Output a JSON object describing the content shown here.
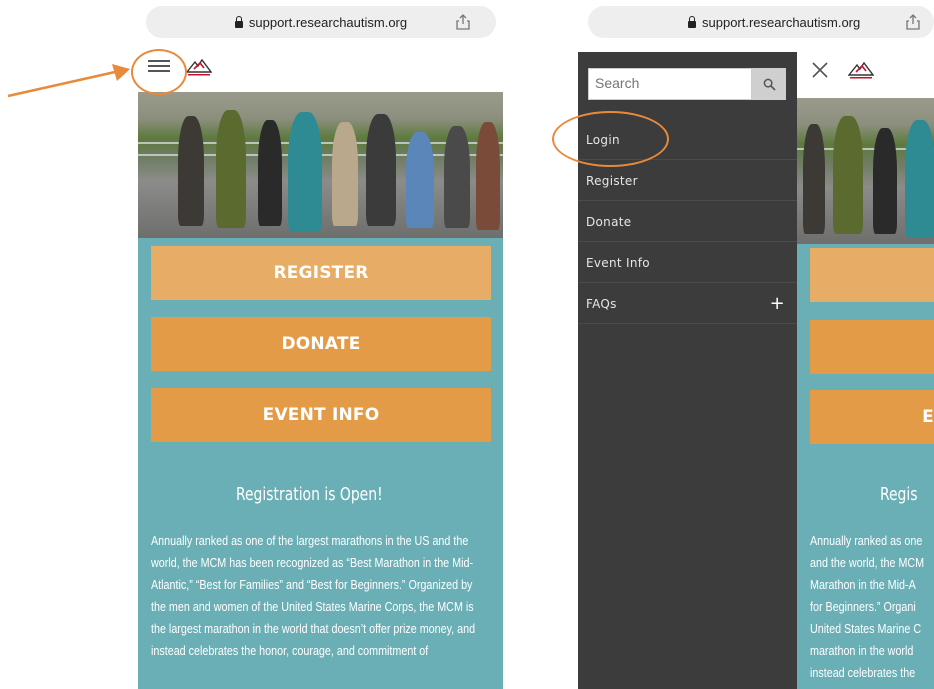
{
  "left_phone": {
    "address_bar": {
      "url": "support.researchautism.org",
      "lock_icon": "lock-icon",
      "share_icon": "share-icon"
    },
    "header": {
      "menu_icon": "hamburger-icon",
      "logo": "rcm-logo"
    },
    "buttons": [
      {
        "label": "REGISTER"
      },
      {
        "label": "DONATE"
      },
      {
        "label": "EVENT INFO"
      }
    ],
    "heading": "Registration is Open!",
    "body_text": "Annually ranked as one of the largest marathons in the US and the world, the MCM has been recognized as “Best Marathon in the Mid-Atlantic,” “Best for Families” and “Best for Beginners.” Organized by the men and women of the United States Marine Corps, the MCM is the largest marathon in the world that doesn’t offer prize money, and instead celebrates the honor, courage, and commitment of"
  },
  "right_phone": {
    "address_bar": {
      "url": "support.researchautism.org"
    },
    "header": {
      "close_icon": "close-icon"
    },
    "search": {
      "placeholder": "Search"
    },
    "menu_items": [
      {
        "label": "Login"
      },
      {
        "label": "Register"
      },
      {
        "label": "Donate"
      },
      {
        "label": "Event Info"
      },
      {
        "label": "FAQs",
        "expand": "+"
      }
    ],
    "heading_partial": "Regis",
    "body_lines_partial": [
      "Annually ranked as one",
      "and the world, the MCM",
      "Marathon in the Mid-A",
      "for Beginners.” Organi",
      "United States Marine C",
      "marathon in the world",
      "instead celebrates the"
    ],
    "button_partial_label": "E"
  },
  "colors": {
    "teal": "#6aafb6",
    "button_light": "#e7ac66",
    "button_dark": "#e49b48",
    "drawer": "#3c3c3c",
    "annotation": "#e88a3a"
  }
}
